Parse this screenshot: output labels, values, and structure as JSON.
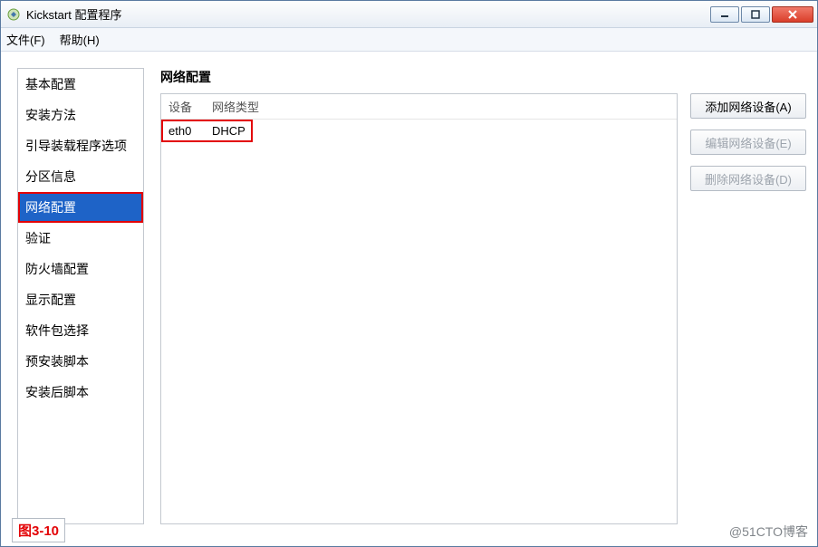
{
  "window": {
    "title": "Kickstart 配置程序"
  },
  "menu": {
    "file": "文件(F)",
    "help": "帮助(H)"
  },
  "sidebar": {
    "items": [
      {
        "label": "基本配置"
      },
      {
        "label": "安装方法"
      },
      {
        "label": "引导装载程序选项"
      },
      {
        "label": "分区信息"
      },
      {
        "label": "网络配置",
        "selected": true
      },
      {
        "label": "验证"
      },
      {
        "label": "防火墙配置"
      },
      {
        "label": "显示配置"
      },
      {
        "label": "软件包选择"
      },
      {
        "label": "预安装脚本"
      },
      {
        "label": "安装后脚本"
      }
    ]
  },
  "main": {
    "title": "网络配置",
    "columns": {
      "device": "设备",
      "type": "网络类型"
    },
    "rows": [
      {
        "device": "eth0",
        "type": "DHCP"
      }
    ]
  },
  "buttons": {
    "add": "添加网络设备(A)",
    "edit": "编辑网络设备(E)",
    "delete": "删除网络设备(D)"
  },
  "figure": {
    "label": "图3-10"
  },
  "watermark": "@51CTO博客"
}
